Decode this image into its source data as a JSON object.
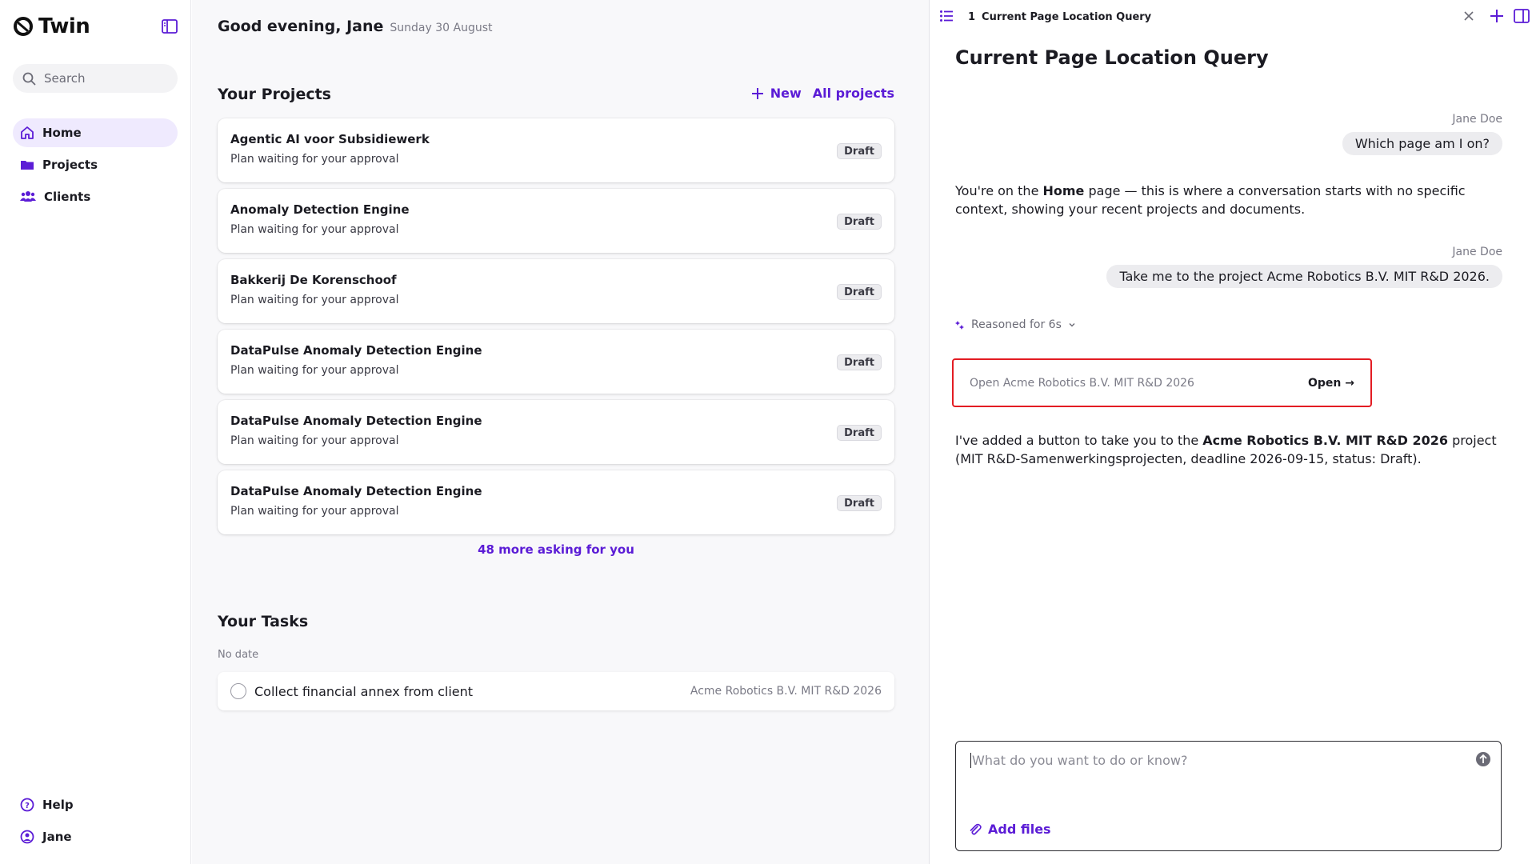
{
  "app": {
    "name": "Twin"
  },
  "sidebar": {
    "search_placeholder": "Search",
    "nav": [
      {
        "label": "Home",
        "icon": "home-icon",
        "active": true
      },
      {
        "label": "Projects",
        "icon": "folder-icon",
        "active": false
      },
      {
        "label": "Clients",
        "icon": "users-icon",
        "active": false
      }
    ],
    "bottom": [
      {
        "label": "Help",
        "icon": "help-icon"
      },
      {
        "label": "Jane",
        "icon": "user-icon"
      }
    ]
  },
  "main": {
    "greeting": "Good evening, Jane",
    "date": "Sunday 30 August",
    "projects_title": "Your Projects",
    "new_label": "New",
    "all_projects_label": "All projects",
    "projects": [
      {
        "name": "Agentic AI voor Subsidiewerk",
        "status": "Plan waiting for your approval",
        "badge": "Draft"
      },
      {
        "name": "Anomaly Detection Engine",
        "status": "Plan waiting for your approval",
        "badge": "Draft"
      },
      {
        "name": "Bakkerij De Korenschoof",
        "status": "Plan waiting for your approval",
        "badge": "Draft"
      },
      {
        "name": "DataPulse Anomaly Detection Engine",
        "status": "Plan waiting for your approval",
        "badge": "Draft"
      },
      {
        "name": "DataPulse Anomaly Detection Engine",
        "status": "Plan waiting for your approval",
        "badge": "Draft"
      },
      {
        "name": "DataPulse Anomaly Detection Engine",
        "status": "Plan waiting for your approval",
        "badge": "Draft"
      }
    ],
    "more_label": "48 more asking for you",
    "tasks_title": "Your Tasks",
    "tasks_group": "No date",
    "tasks": [
      {
        "name": "Collect financial annex from client",
        "project": "Acme Robotics B.V. MIT R&D 2026"
      }
    ]
  },
  "panel": {
    "tab_number": "1",
    "tab_title": "Current Page Location Query",
    "title": "Current Page Location Query",
    "messages": [
      {
        "who": "Jane Doe",
        "text": "Which page am I on?"
      },
      {
        "who": "Jane Doe",
        "text": "Take me to the project Acme Robotics B.V. MIT R&D 2026."
      }
    ],
    "reply1": {
      "pre": "You're on the ",
      "bold": "Home",
      "post": " page — this is where a conversation starts with no specific context, showing your recent projects and documents."
    },
    "reasoned_label": "Reasoned for 6s",
    "action": {
      "text": "Open Acme Robotics B.V. MIT R&D 2026",
      "button": "Open →"
    },
    "reply2": {
      "pre": "I've added a button to take you to the ",
      "bold": "Acme Robotics B.V. MIT R&D 2026",
      "post": " project (MIT R&D-Samenwerkingsprojecten, deadline 2026-09-15, status: Draft)."
    },
    "composer": {
      "placeholder": "What do you want to do or know?",
      "add_files": "Add files"
    }
  },
  "colors": {
    "accent": "#5b1cd6",
    "highlight": "#e31c23",
    "active_nav": "#efeafe"
  }
}
